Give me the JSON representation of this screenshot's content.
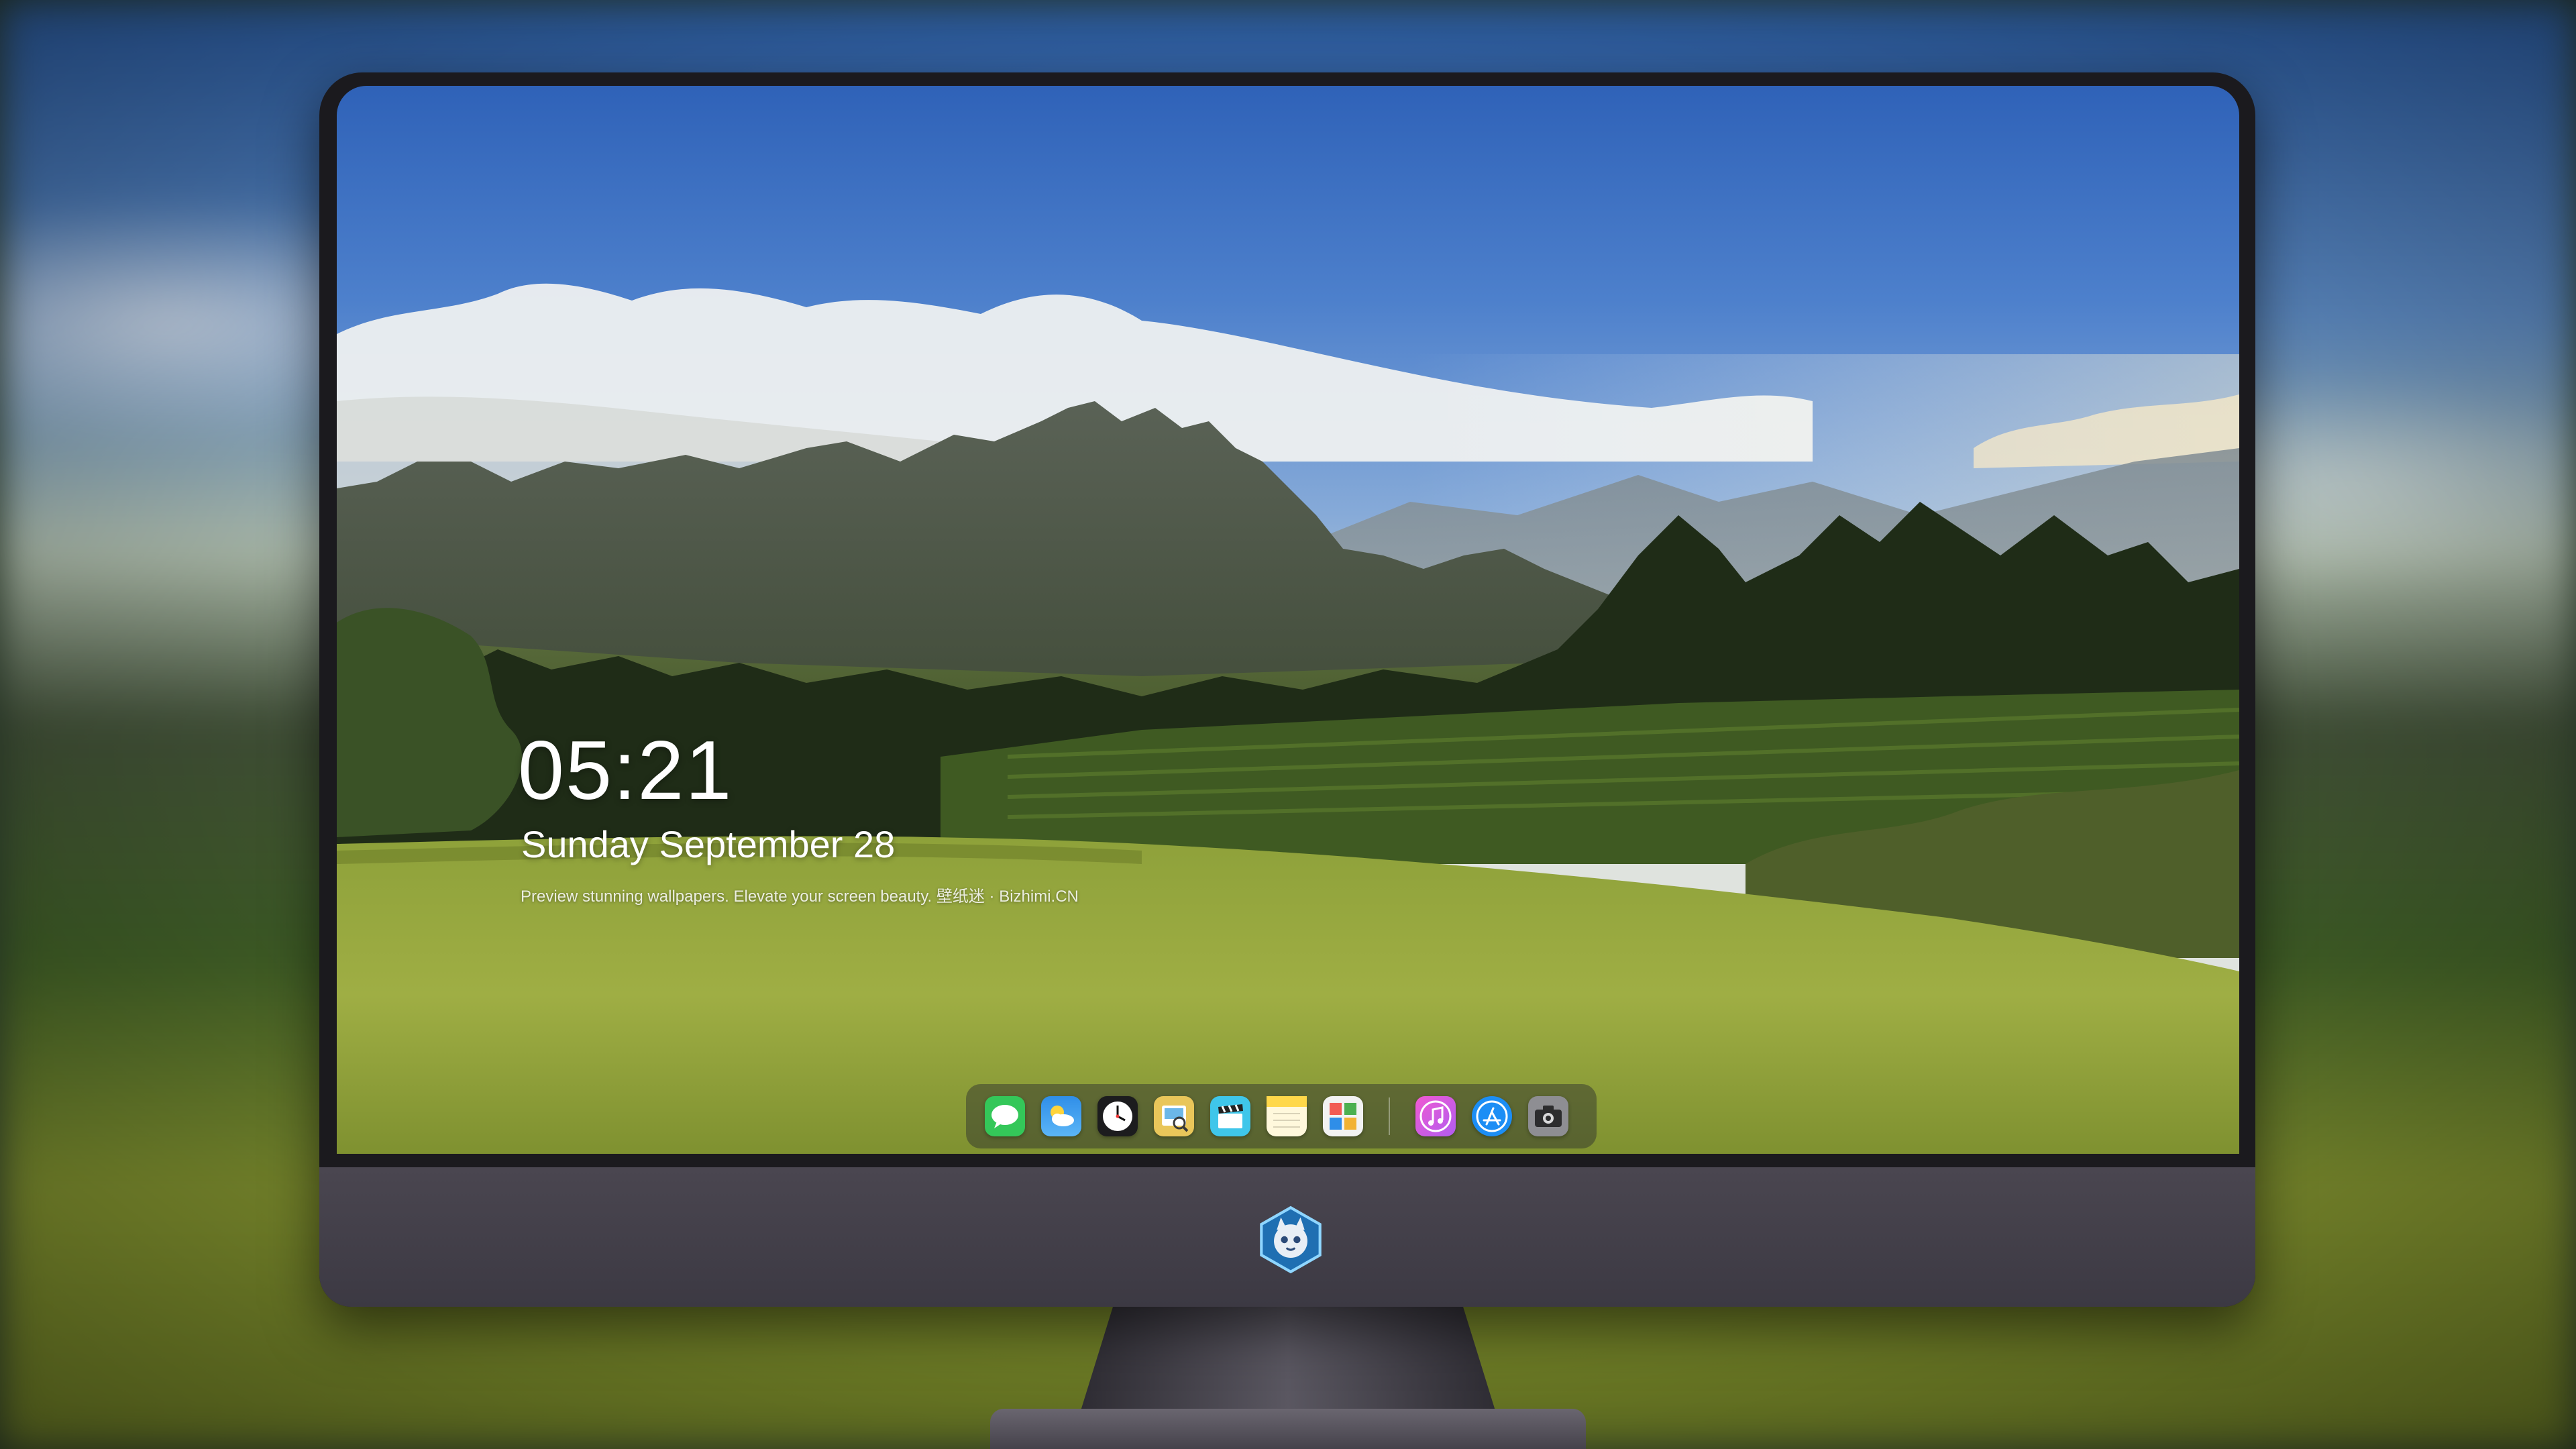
{
  "lock_screen": {
    "time": "05:21",
    "date": "Sunday September  28",
    "caption": "Preview stunning wallpapers. Elevate your screen beauty. 壁纸迷 · Bizhimi.CN"
  },
  "dock": {
    "apps": [
      {
        "name": "Messages",
        "icon": "messages-icon",
        "color": "#34c759"
      },
      {
        "name": "Weather",
        "icon": "weather-icon",
        "color": "#2f8ee8"
      },
      {
        "name": "Clock",
        "icon": "clock-icon",
        "color": "#1c1c1e"
      },
      {
        "name": "Preview",
        "icon": "preview-icon",
        "color": "#e9c65a"
      },
      {
        "name": "Clips",
        "icon": "clapperboard-icon",
        "color": "#3fc6ea"
      },
      {
        "name": "Notes",
        "icon": "notes-icon",
        "color": "#ffd84a"
      },
      {
        "name": "Photo Booth",
        "icon": "photo-grid-icon",
        "color": "#f2f2f2"
      },
      {
        "name": "iTunes",
        "icon": "music-icon",
        "color": "#d45ee0"
      },
      {
        "name": "App Store",
        "icon": "app-store-icon",
        "color": "#1c8ef5"
      },
      {
        "name": "Camera",
        "icon": "camera-icon",
        "color": "#8e8e93"
      }
    ]
  },
  "monitor": {
    "chin_logo": "logo-icon",
    "colors": {
      "frame": "#1b1a1e",
      "chin": "#45424b",
      "stand": "#5a5761"
    }
  }
}
